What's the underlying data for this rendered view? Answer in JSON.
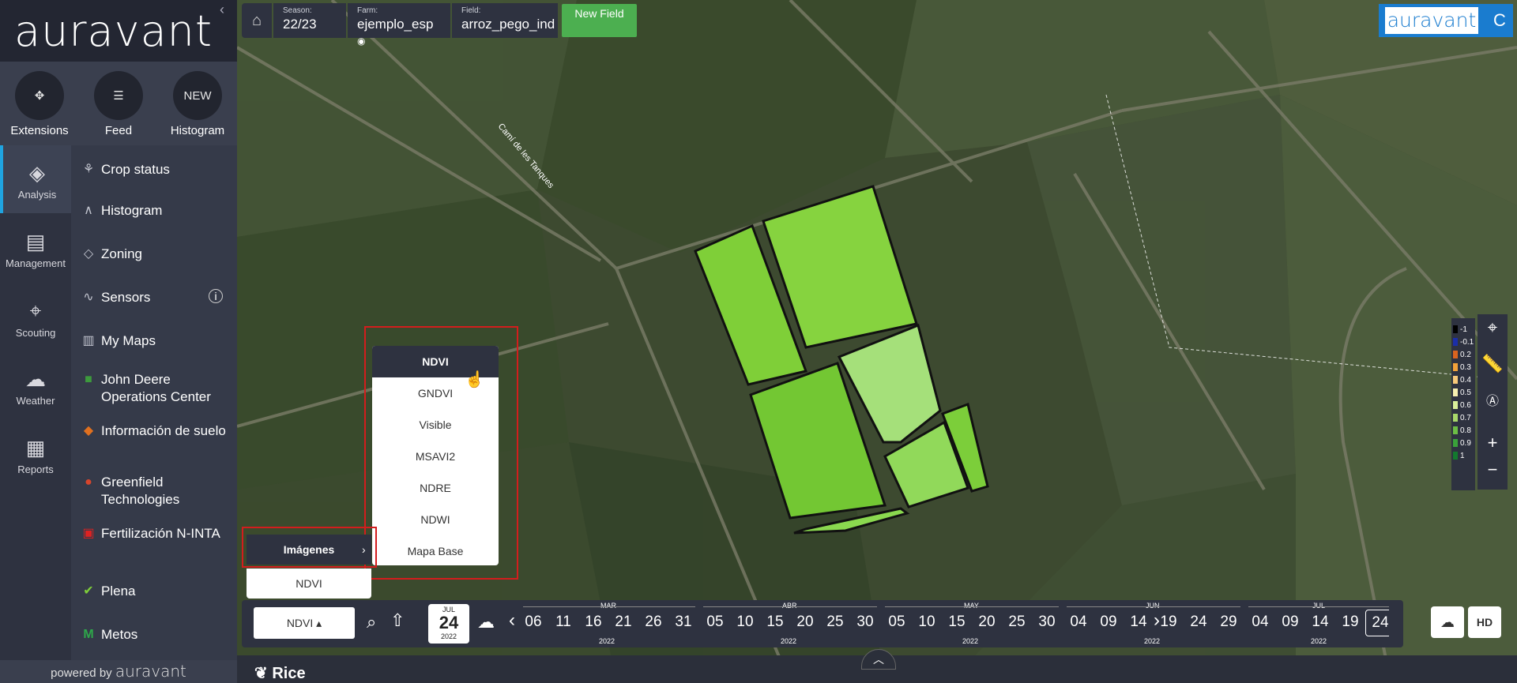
{
  "brand": {
    "logo": "auravant",
    "corner_logo": "auravant",
    "corner_initial": "C",
    "powered_prefix": "powered by",
    "powered_brand": "auravant"
  },
  "extensions": [
    {
      "label": "Extensions",
      "icon": "puzzle-icon",
      "glyph": "✥"
    },
    {
      "label": "Feed",
      "icon": "chat-icon",
      "glyph": "☰"
    },
    {
      "label": "Histogram",
      "icon": "new-badge",
      "glyph": "NEW"
    }
  ],
  "nav": [
    {
      "label": "Analysis",
      "glyph": "◈",
      "active": true
    },
    {
      "label": "Management",
      "glyph": "▤"
    },
    {
      "label": "Scouting",
      "glyph": "⌖"
    },
    {
      "label": "Weather",
      "glyph": "☁"
    },
    {
      "label": "Reports",
      "glyph": "▦"
    }
  ],
  "menu": [
    {
      "label": "Crop status",
      "glyph": "⚘"
    },
    {
      "label": "Histogram",
      "glyph": "∧"
    },
    {
      "label": "Zoning",
      "glyph": "◇"
    },
    {
      "label": "Sensors",
      "glyph": "∿",
      "info": "i"
    },
    {
      "label": "My Maps",
      "glyph": "▥"
    },
    {
      "label": "John Deere Operations Center",
      "glyph": "■"
    },
    {
      "label": "Información de suelo",
      "glyph": "◆"
    },
    {
      "label": "Greenfield Technologies",
      "glyph": "●"
    },
    {
      "label": "Fertilización N-INTA",
      "glyph": "▣"
    },
    {
      "label": "Plena",
      "glyph": "✔"
    },
    {
      "label": "Metos",
      "glyph": "M"
    }
  ],
  "topbar": {
    "season_key": "Season:",
    "season": "22/23",
    "farm_key": "Farm:",
    "farm": "ejemplo_esp",
    "farm_eye": "◉",
    "field_key": "Field:",
    "field": "arroz_pego_ind",
    "new_field": "New Field"
  },
  "road_label": "Camí de les Tanques",
  "image_types": [
    "NDVI",
    "GNDVI",
    "Visible",
    "MSAVI2",
    "NDRE",
    "NDWI",
    "Mapa Base"
  ],
  "images_panel": {
    "title": "Imágenes",
    "value": "NDVI"
  },
  "legend": [
    {
      "label": "-1",
      "color": "#000000"
    },
    {
      "label": "-0.1",
      "color": "#1b2ea8"
    },
    {
      "label": "0.2",
      "color": "#d9641f"
    },
    {
      "label": "0.3",
      "color": "#f2a23a"
    },
    {
      "label": "0.4",
      "color": "#f7c97a"
    },
    {
      "label": "0.5",
      "color": "#f6efb0"
    },
    {
      "label": "0.6",
      "color": "#d9ef9a"
    },
    {
      "label": "0.7",
      "color": "#a8d86a"
    },
    {
      "label": "0.8",
      "color": "#6cbd45"
    },
    {
      "label": "0.9",
      "color": "#3aa13a"
    },
    {
      "label": "1",
      "color": "#137a2e"
    }
  ],
  "timeline": {
    "layer": "NDVI ▴",
    "date": {
      "month": "JUL",
      "day": "24",
      "year": "2022"
    },
    "months": [
      {
        "label": "MAR",
        "year": "2022",
        "days": [
          "06",
          "11",
          "16",
          "21",
          "26",
          "31"
        ]
      },
      {
        "label": "ABR",
        "year": "2022",
        "days": [
          "05",
          "10",
          "15",
          "20",
          "25",
          "30"
        ]
      },
      {
        "label": "MAY",
        "year": "2022",
        "days": [
          "05",
          "10",
          "15",
          "20",
          "25",
          "30"
        ]
      },
      {
        "label": "JUN",
        "year": "2022",
        "days": [
          "04",
          "09",
          "14",
          "19",
          "24",
          "29"
        ]
      },
      {
        "label": "JUL",
        "year": "2022",
        "days": [
          "04",
          "09",
          "14",
          "19",
          "24"
        ]
      }
    ],
    "selected": "24",
    "hd": "HD"
  },
  "crop": "Rice"
}
